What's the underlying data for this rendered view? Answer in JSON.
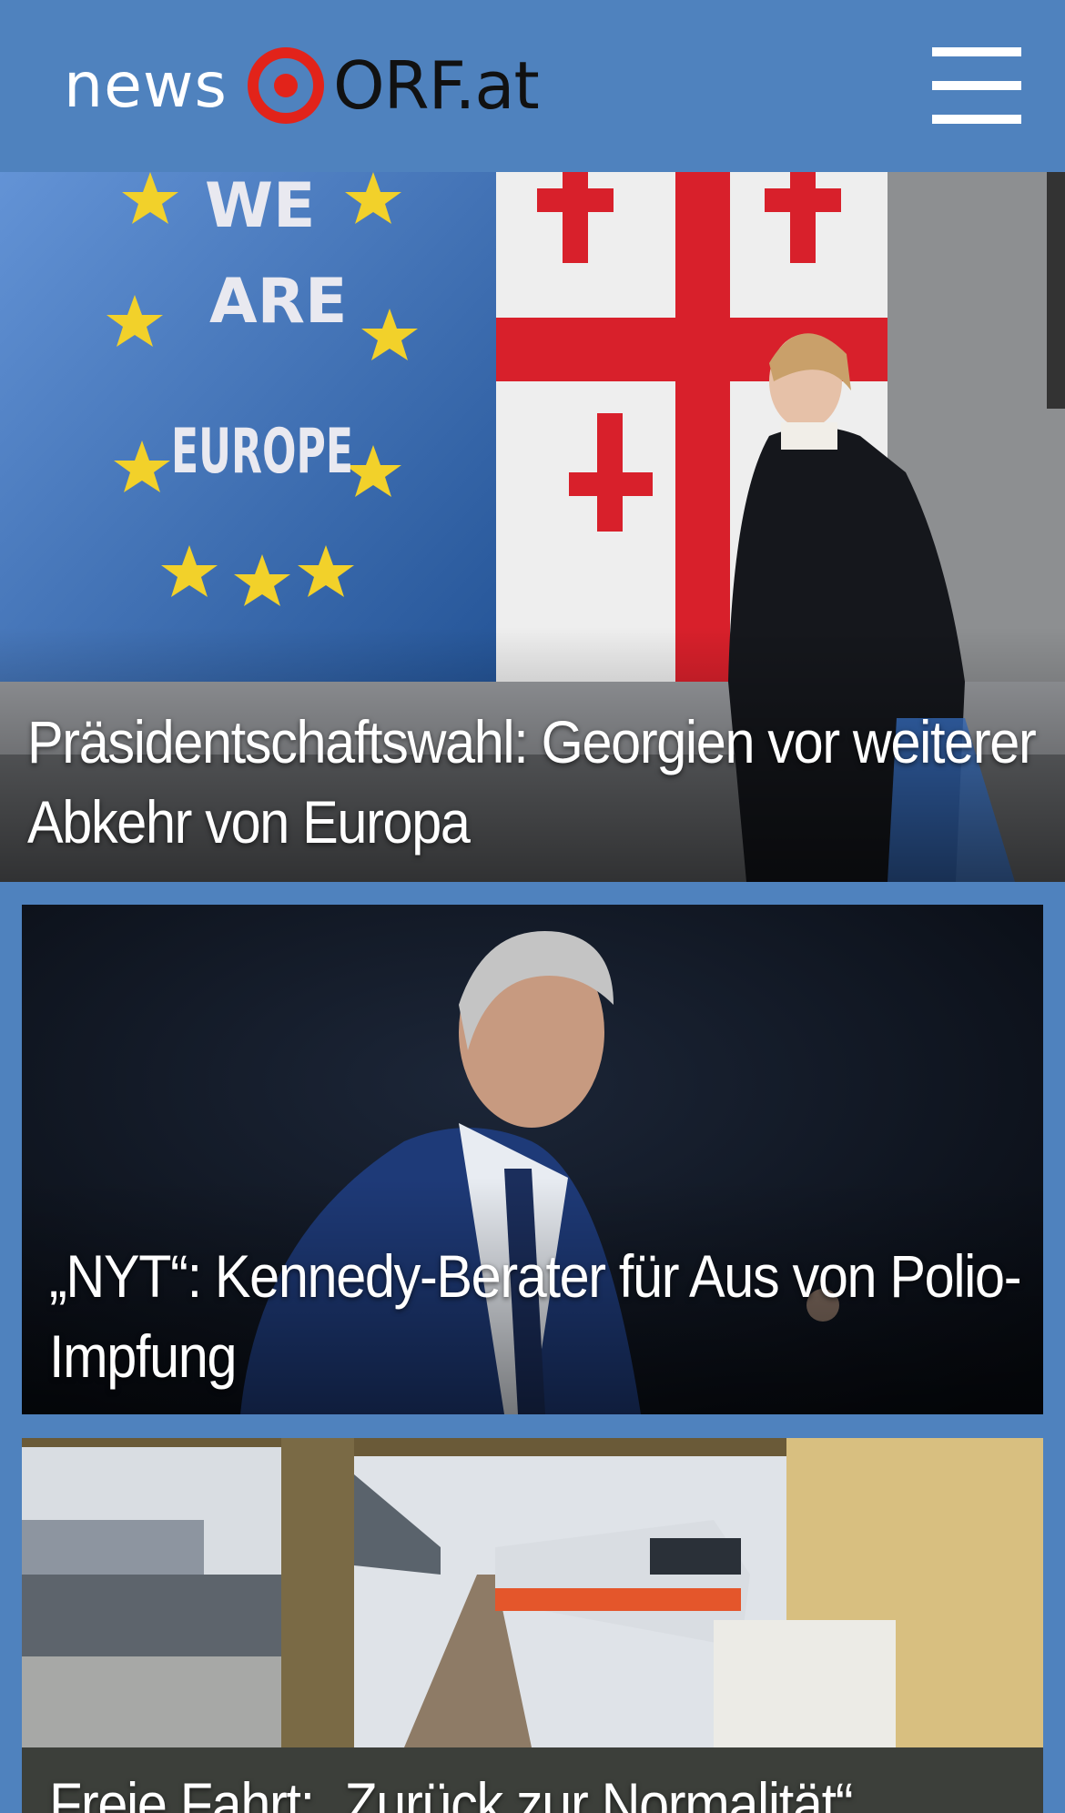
{
  "header": {
    "logo_news": "news",
    "logo_orf": "ORF.at",
    "menu_icon": "hamburger-menu-icon",
    "background_color": "#4f82be",
    "logo_mark_color": "#e2231a"
  },
  "stories": [
    {
      "headline": "Präsidentschaftswahl: Georgien vor weiterer Abkehr von Europa",
      "image_text": "WE ARE EUROPE"
    },
    {
      "headline": "„NYT“: Kennedy-Berater für Aus von Polio-Impfung"
    },
    {
      "headline": "Freie Fahrt: „Zurück zur Normalität“"
    }
  ]
}
